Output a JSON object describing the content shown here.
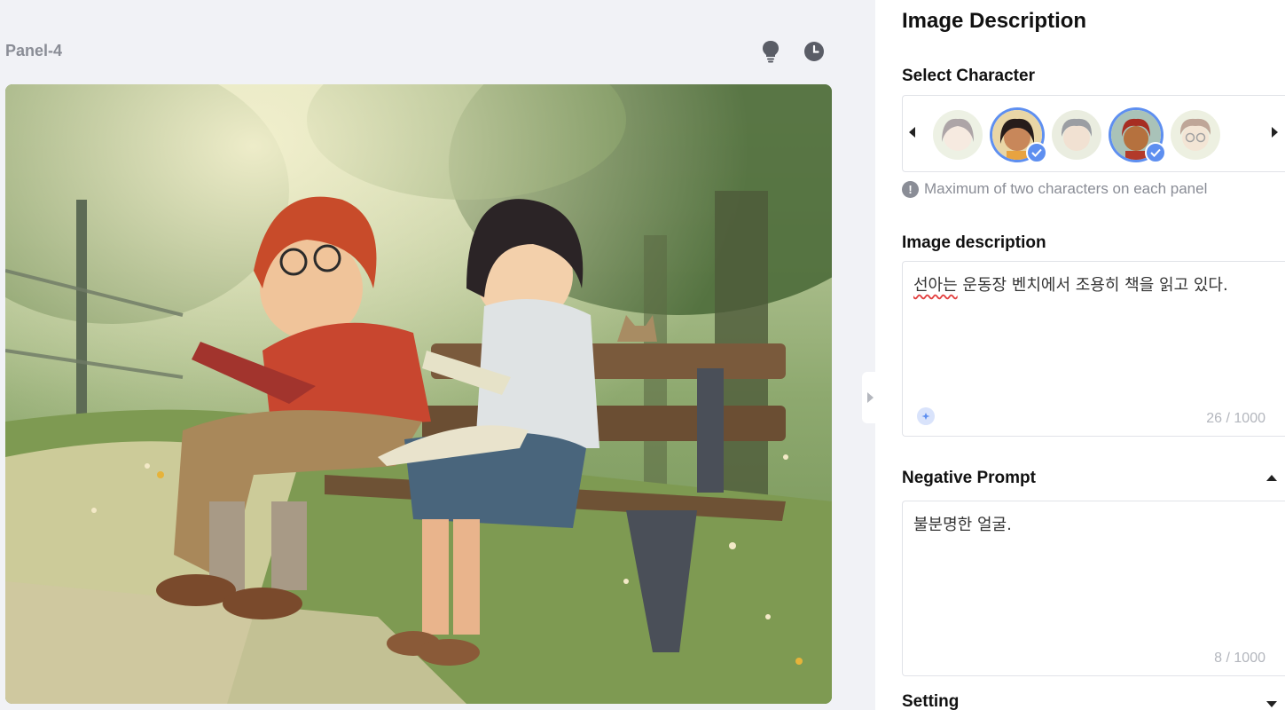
{
  "panel": {
    "title": "Panel-4"
  },
  "sidebar": {
    "title": "Image Description",
    "select_character": {
      "label": "Select Character",
      "avatars": [
        {
          "name": "girl-gray",
          "selected": false
        },
        {
          "name": "girl-dark-hair",
          "selected": true
        },
        {
          "name": "boy-gray",
          "selected": false
        },
        {
          "name": "boy-red-hair",
          "selected": true
        },
        {
          "name": "boy-glasses-gray",
          "selected": false
        }
      ],
      "note": "Maximum of two characters on each panel"
    },
    "image_description": {
      "label": "Image description",
      "value_underlined": "선아는",
      "value_rest": " 운동장 벤치에서 조용히 책을 읽고 있다.",
      "count": "26 / 1000"
    },
    "negative_prompt": {
      "label": "Negative Prompt",
      "value": "불분명한 얼굴.",
      "count": "8 / 1000"
    },
    "setting": {
      "label": "Setting"
    }
  },
  "colors": {
    "accent": "#5e8ff0",
    "muted_text": "#8a8d96",
    "panel_bg": "#f1f2f6",
    "border": "#e1e3e8"
  }
}
